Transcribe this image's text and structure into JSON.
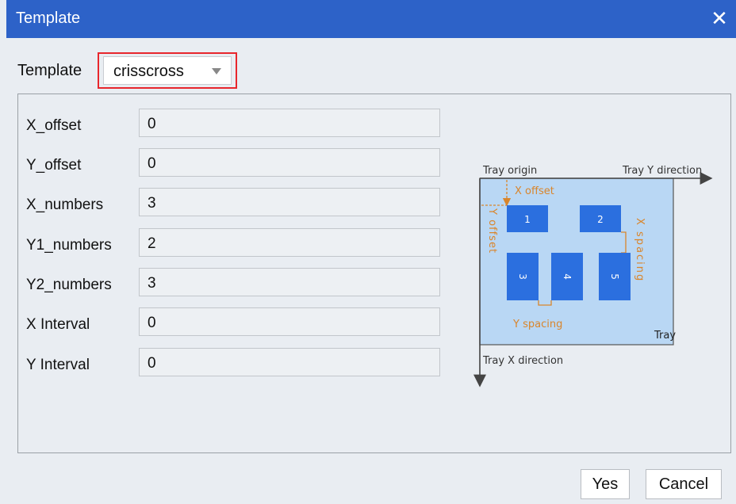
{
  "window": {
    "title": "Template"
  },
  "template": {
    "label": "Template",
    "selected": "crisscross"
  },
  "fields": [
    {
      "label": "X_offset",
      "value": "0"
    },
    {
      "label": "Y_offset",
      "value": "0"
    },
    {
      "label": "X_numbers",
      "value": "3"
    },
    {
      "label": "Y1_numbers",
      "value": "2"
    },
    {
      "label": "Y2_numbers",
      "value": "3"
    },
    {
      "label": "X Interval",
      "value": "0"
    },
    {
      "label": "Y Interval",
      "value": "0"
    }
  ],
  "diagram": {
    "tray_origin": "Tray origin",
    "tray_y_direction": "Tray Y direction",
    "tray_x_direction": "Tray X direction",
    "x_offset": "X offset",
    "y_offset": "Y offset",
    "x_spacing": "X spacing",
    "y_spacing": "Y spacing",
    "tray": "Tray",
    "slots": [
      "1",
      "2",
      "3",
      "4",
      "5"
    ],
    "colors": {
      "tray_fill": "#b9d7f4",
      "slot_fill": "#2b6fdf",
      "annotation": "#d9852b"
    }
  },
  "buttons": {
    "yes": "Yes",
    "cancel": "Cancel"
  }
}
